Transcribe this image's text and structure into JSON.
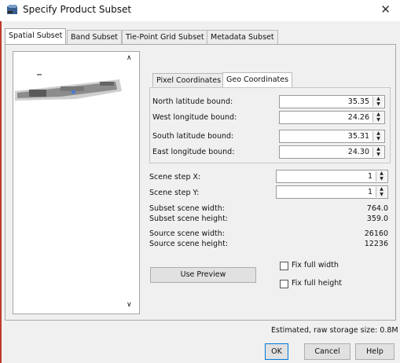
{
  "window": {
    "title": "Specify Product Subset",
    "close_glyph": "✕"
  },
  "tabs": [
    {
      "label": "Spatial Subset",
      "active": true
    },
    {
      "label": "Band Subset",
      "active": false
    },
    {
      "label": "Tie-Point Grid Subset",
      "active": false
    },
    {
      "label": "Metadata Subset",
      "active": false
    }
  ],
  "subtabs": [
    {
      "label": "Pixel Coordinates",
      "active": false
    },
    {
      "label": "Geo Coordinates",
      "active": true
    }
  ],
  "geo": {
    "north_label": "North latitude bound:",
    "north_value": "35.35",
    "west_label": "West longitude bound:",
    "west_value": "24.26",
    "south_label": "South latitude bound:",
    "south_value": "35.31",
    "east_label": "East longitude bound:",
    "east_value": "24.30"
  },
  "scene": {
    "step_x_label": "Scene step X:",
    "step_x_value": "1",
    "step_y_label": "Scene step Y:",
    "step_y_value": "1",
    "subset_width_label": "Subset scene width:",
    "subset_width_value": "764.0",
    "subset_height_label": "Subset scene height:",
    "subset_height_value": "359.0",
    "source_width_label": "Source scene width:",
    "source_width_value": "26160",
    "source_height_label": "Source scene height:",
    "source_height_value": "12236"
  },
  "buttons": {
    "use_preview": "Use Preview",
    "fix_width": "Fix full width",
    "fix_height": "Fix full height",
    "ok": "OK",
    "cancel": "Cancel",
    "help": "Help"
  },
  "status": {
    "storage": "Estimated, raw storage size: 0.8M"
  },
  "icons": {
    "spin_up": "▲",
    "spin_down": "▼",
    "scroll_up": "∧",
    "scroll_down": "∨"
  },
  "colors": {
    "accent_border": "#0078d7",
    "left_edge": "#c0392b"
  }
}
